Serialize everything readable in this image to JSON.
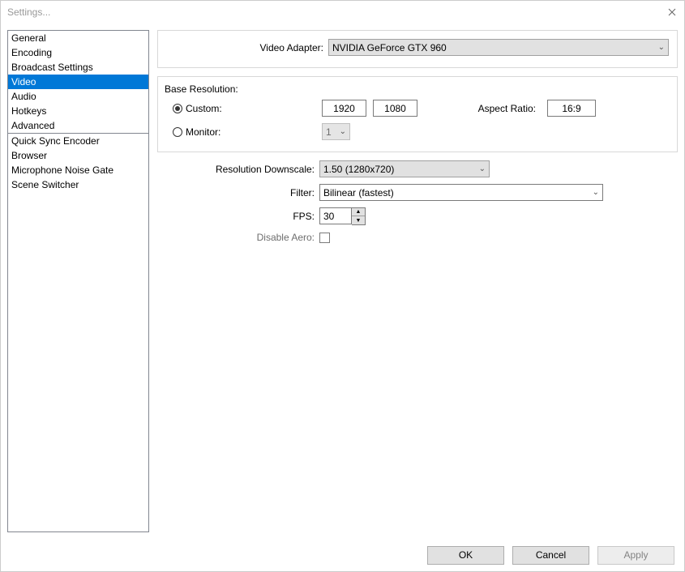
{
  "window": {
    "title": "Settings..."
  },
  "sidebar": {
    "items": [
      {
        "label": "General"
      },
      {
        "label": "Encoding"
      },
      {
        "label": "Broadcast Settings"
      },
      {
        "label": "Video",
        "selected": true
      },
      {
        "label": "Audio"
      },
      {
        "label": "Hotkeys"
      },
      {
        "label": "Advanced"
      }
    ],
    "items2": [
      {
        "label": "Quick Sync Encoder"
      },
      {
        "label": "Browser"
      },
      {
        "label": "Microphone Noise Gate"
      },
      {
        "label": "Scene Switcher"
      }
    ]
  },
  "video": {
    "adapter_label": "Video Adapter:",
    "adapter_value": "NVIDIA GeForce GTX 960",
    "base_res_label": "Base Resolution:",
    "custom_label": "Custom:",
    "monitor_label": "Monitor:",
    "width": "1920",
    "height": "1080",
    "aspect_label": "Aspect Ratio:",
    "aspect_value": "16:9",
    "monitor_value": "1",
    "downscale_label": "Resolution Downscale:",
    "downscale_value": "1.50  (1280x720)",
    "filter_label": "Filter:",
    "filter_value": "Bilinear (fastest)",
    "fps_label": "FPS:",
    "fps_value": "30",
    "aero_label": "Disable Aero:"
  },
  "buttons": {
    "ok": "OK",
    "cancel": "Cancel",
    "apply": "Apply"
  }
}
